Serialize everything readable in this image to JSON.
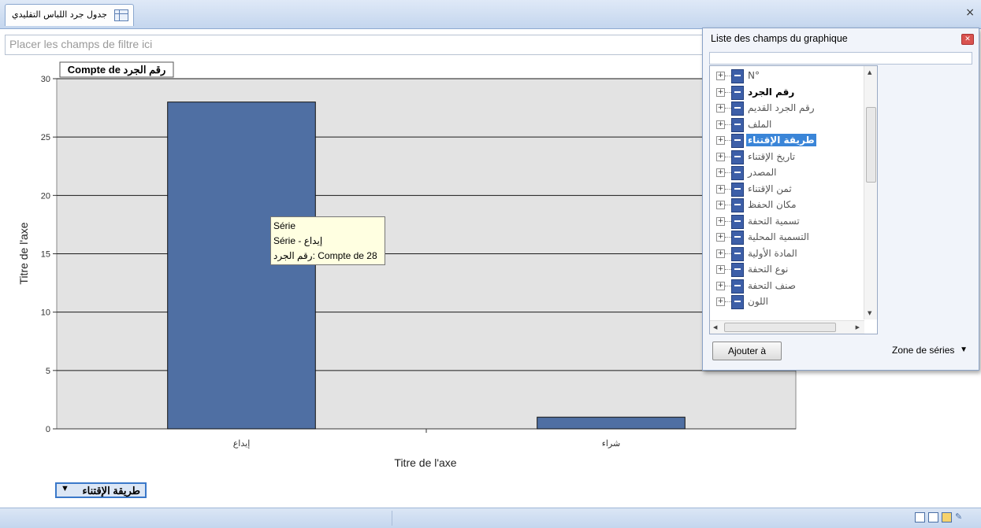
{
  "window": {
    "tab_title": "جدول جرد اللباس التقليدي",
    "close_symbol": "×"
  },
  "filter_zone": {
    "placeholder": "Placer les champs de filtre ici"
  },
  "chart_data": {
    "type": "bar",
    "title": "رقم الجرد Compte de",
    "categories": [
      "إيداع",
      "شراء"
    ],
    "series": [
      {
        "name": "Série",
        "values": [
          28,
          1
        ]
      }
    ],
    "xlabel": "Titre de l'axe",
    "ylabel": "Titre de l'axe",
    "ylim": [
      0,
      30
    ],
    "yticks": [
      0,
      5,
      10,
      15,
      20,
      25,
      30
    ],
    "grid": true,
    "bar_color": "#4f6fa3"
  },
  "tooltip": {
    "line1": "Série",
    "line2": "Série - إيداع",
    "line3": "رقم الجرد: Compte de 28"
  },
  "category_field": {
    "label": "طريقة الإقتناء",
    "arrow": "▼"
  },
  "field_list": {
    "title": "Liste des champs du graphique",
    "items": [
      {
        "label": "N°",
        "style": "normal"
      },
      {
        "label": "رقم الجرد",
        "style": "bold"
      },
      {
        "label": "رقم الجرد القديم",
        "style": "normal"
      },
      {
        "label": "الملف",
        "style": "normal"
      },
      {
        "label": "طريقة الإقتناء",
        "style": "selected"
      },
      {
        "label": "تاريخ الإقتناء",
        "style": "normal"
      },
      {
        "label": "المصدر",
        "style": "normal"
      },
      {
        "label": "ثمن الإقتناء",
        "style": "normal"
      },
      {
        "label": "مكان الحفظ",
        "style": "normal"
      },
      {
        "label": "تسمية التحفة",
        "style": "normal"
      },
      {
        "label": "التسمية المحلية",
        "style": "normal"
      },
      {
        "label": "المادة الأولية",
        "style": "normal"
      },
      {
        "label": "نوع التحفة",
        "style": "normal"
      },
      {
        "label": "صنف التحفة",
        "style": "normal"
      },
      {
        "label": "اللون",
        "style": "normal"
      }
    ],
    "add_button": "Ajouter à",
    "zone_select": "Zone de séries",
    "zone_arrow": "▼"
  }
}
